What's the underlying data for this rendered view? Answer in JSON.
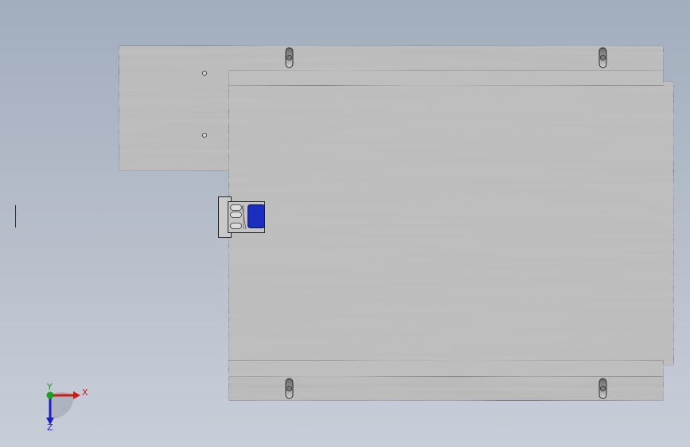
{
  "viewport": {
    "background_top": "#a2adbd",
    "background_bottom": "#c8ced8"
  },
  "model": {
    "material": "brushed-metal",
    "edge_color": "#2a2a2a",
    "connector_color": "#1a2fbf"
  },
  "triad": {
    "x_label": "X",
    "y_label": "Y",
    "z_label": "Z",
    "x_color": "#c81e1e",
    "y_color": "#1ea01e",
    "z_color": "#1e1ec8"
  }
}
